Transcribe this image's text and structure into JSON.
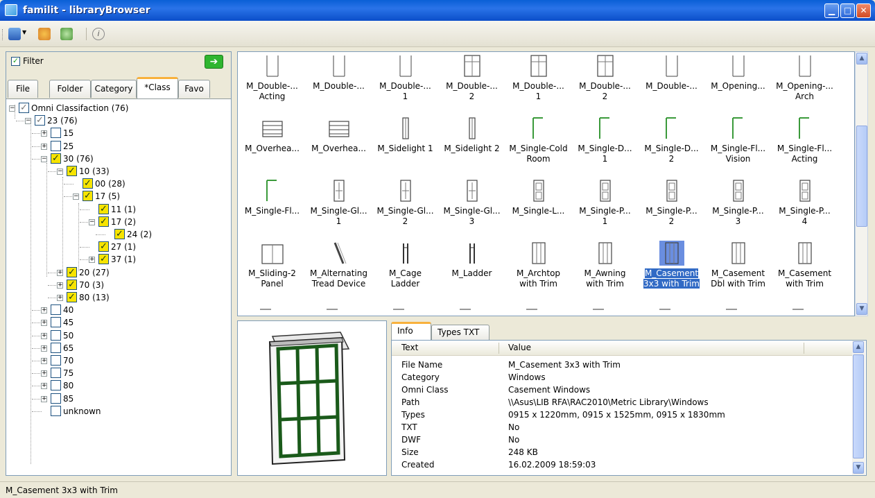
{
  "window": {
    "title": "familit - libraryBrowser",
    "minimize": "▁",
    "maximize": "□",
    "close": "✕"
  },
  "toolbar": {
    "icons": [
      "open-folder-icon",
      "palette-icon",
      "refresh-icon",
      "info-icon"
    ]
  },
  "filter": {
    "label": "Filter",
    "checked": true,
    "go_glyph": "➔"
  },
  "left_tabs": [
    {
      "label": "File",
      "active": false
    },
    {
      "label": "Folder",
      "active": false
    },
    {
      "label": "Category",
      "active": false
    },
    {
      "label": "*Class",
      "active": true
    },
    {
      "label": "Favo",
      "active": false
    }
  ],
  "tree": [
    {
      "label": "Omni Classifaction (76)",
      "depth": 0,
      "exp": "−",
      "check": "grey"
    },
    {
      "label": "23 (76)",
      "depth": 1,
      "exp": "−",
      "check": "grey"
    },
    {
      "label": "15",
      "depth": 2,
      "exp": "+",
      "check": "off"
    },
    {
      "label": "25",
      "depth": 2,
      "exp": "+",
      "check": "off"
    },
    {
      "label": "30 (76)",
      "depth": 2,
      "exp": "−",
      "check": "on"
    },
    {
      "label": "10 (33)",
      "depth": 3,
      "exp": "−",
      "check": "on"
    },
    {
      "label": "00 (28)",
      "depth": 4,
      "exp": "",
      "check": "on"
    },
    {
      "label": "17 (5)",
      "depth": 4,
      "exp": "−",
      "check": "on"
    },
    {
      "label": "11 (1)",
      "depth": 5,
      "exp": "",
      "check": "on"
    },
    {
      "label": "17 (2)",
      "depth": 5,
      "exp": "−",
      "check": "on"
    },
    {
      "label": "24 (2)",
      "depth": 6,
      "exp": "",
      "check": "on"
    },
    {
      "label": "27 (1)",
      "depth": 5,
      "exp": "",
      "check": "on"
    },
    {
      "label": "37 (1)",
      "depth": 5,
      "exp": "+",
      "check": "on"
    },
    {
      "label": "20 (27)",
      "depth": 3,
      "exp": "+",
      "check": "on"
    },
    {
      "label": "70 (3)",
      "depth": 3,
      "exp": "+",
      "check": "on"
    },
    {
      "label": "80 (13)",
      "depth": 3,
      "exp": "+",
      "check": "on"
    },
    {
      "label": "40",
      "depth": 2,
      "exp": "+",
      "check": "off"
    },
    {
      "label": "45",
      "depth": 2,
      "exp": "+",
      "check": "off"
    },
    {
      "label": "50",
      "depth": 2,
      "exp": "+",
      "check": "off"
    },
    {
      "label": "65",
      "depth": 2,
      "exp": "+",
      "check": "off"
    },
    {
      "label": "70",
      "depth": 2,
      "exp": "+",
      "check": "off"
    },
    {
      "label": "75",
      "depth": 2,
      "exp": "+",
      "check": "off"
    },
    {
      "label": "80",
      "depth": 2,
      "exp": "+",
      "check": "off"
    },
    {
      "label": "85",
      "depth": 2,
      "exp": "+",
      "check": "off"
    },
    {
      "label": "unknown",
      "depth": 2,
      "exp": "",
      "check": "off"
    }
  ],
  "families": [
    {
      "l1": "M_Double-...",
      "l2": "Acting",
      "icon": "door-frame-icon"
    },
    {
      "l1": "M_Double-...",
      "l2": "",
      "icon": "door-frame-icon"
    },
    {
      "l1": "M_Double-...",
      "l2": "1",
      "icon": "door-frame-icon"
    },
    {
      "l1": "M_Double-...",
      "l2": "2",
      "icon": "door-grid-icon"
    },
    {
      "l1": "M_Double-...",
      "l2": "1",
      "icon": "door-grid-icon"
    },
    {
      "l1": "M_Double-...",
      "l2": "2",
      "icon": "door-grid-icon"
    },
    {
      "l1": "M_Double-...",
      "l2": "",
      "icon": "door-frame-icon"
    },
    {
      "l1": "M_Opening...",
      "l2": "",
      "icon": "opening-icon"
    },
    {
      "l1": "M_Opening-...",
      "l2": "Arch",
      "icon": "opening-icon"
    },
    {
      "l1": "M_Overhea...",
      "l2": "",
      "icon": "overhead-door-icon"
    },
    {
      "l1": "M_Overhea...",
      "l2": "",
      "icon": "overhead-door-icon"
    },
    {
      "l1": "M_Sidelight 1",
      "l2": "",
      "icon": "sidelight-icon"
    },
    {
      "l1": "M_Sidelight 2",
      "l2": "",
      "icon": "sidelight-icon"
    },
    {
      "l1": "M_Single-Cold",
      "l2": "Room",
      "icon": "single-door-icon"
    },
    {
      "l1": "M_Single-D...",
      "l2": "1",
      "icon": "single-door-icon"
    },
    {
      "l1": "M_Single-D...",
      "l2": "2",
      "icon": "single-door-icon"
    },
    {
      "l1": "M_Single-Fl...",
      "l2": "Vision",
      "icon": "single-door-icon"
    },
    {
      "l1": "M_Single-Fl...",
      "l2": "Acting",
      "icon": "single-door-icon"
    },
    {
      "l1": "M_Single-Fl...",
      "l2": "",
      "icon": "single-door-icon"
    },
    {
      "l1": "M_Single-Gl...",
      "l2": "1",
      "icon": "glass-door-icon"
    },
    {
      "l1": "M_Single-Gl...",
      "l2": "2",
      "icon": "glass-door-icon"
    },
    {
      "l1": "M_Single-Gl...",
      "l2": "3",
      "icon": "glass-door-icon"
    },
    {
      "l1": "M_Single-L...",
      "l2": "",
      "icon": "louver-door-icon"
    },
    {
      "l1": "M_Single-P...",
      "l2": "1",
      "icon": "panel-door-icon"
    },
    {
      "l1": "M_Single-P...",
      "l2": "2",
      "icon": "panel-door-icon"
    },
    {
      "l1": "M_Single-P...",
      "l2": "3",
      "icon": "panel-door-icon"
    },
    {
      "l1": "M_Single-P...",
      "l2": "4",
      "icon": "panel-door-icon"
    },
    {
      "l1": "M_Sliding-2",
      "l2": "Panel",
      "icon": "sliding-door-icon"
    },
    {
      "l1": "M_Alternating",
      "l2": "Tread Device",
      "icon": "stair-icon"
    },
    {
      "l1": "M_Cage",
      "l2": "Ladder",
      "icon": "ladder-icon"
    },
    {
      "l1": "M_Ladder",
      "l2": "",
      "icon": "ladder-icon"
    },
    {
      "l1": "M_Archtop",
      "l2": "with Trim",
      "icon": "window-icon"
    },
    {
      "l1": "M_Awning",
      "l2": "with Trim",
      "icon": "window-icon"
    },
    {
      "l1": "M_Casement",
      "l2": "3x3 with Trim",
      "icon": "window-icon",
      "selected": true
    },
    {
      "l1": "M_Casement",
      "l2": "Dbl with Trim",
      "icon": "window-icon"
    },
    {
      "l1": "M_Casement",
      "l2": "with Trim",
      "icon": "window-icon"
    }
  ],
  "info": {
    "tabs": [
      {
        "label": "Info",
        "active": true
      },
      {
        "label": "Types TXT",
        "active": false
      }
    ],
    "headers": {
      "text": "Text",
      "value": "Value"
    },
    "rows": [
      {
        "key": "File Name",
        "value": "M_Casement 3x3 with Trim"
      },
      {
        "key": "Category",
        "value": "Windows"
      },
      {
        "key": "Omni Class",
        "value": "Casement Windows"
      },
      {
        "key": "Path",
        "value": "\\\\Asus\\LIB RFA\\RAC2010\\Metric Library\\Windows"
      },
      {
        "key": "Types",
        "value": "0915 x 1220mm, 0915 x 1525mm, 0915 x 1830mm"
      },
      {
        "key": "TXT",
        "value": "No"
      },
      {
        "key": "DWF",
        "value": "No"
      },
      {
        "key": "Size",
        "value": "248 KB"
      },
      {
        "key": "Created",
        "value": "16.02.2009 18:59:03"
      }
    ]
  },
  "status": {
    "text": "M_Casement 3x3 with Trim"
  },
  "colors": {
    "check_on": "#f7e400",
    "selection": "#316ac5",
    "titlebar": "#0a5fd6",
    "tab_accent": "#f8b13c"
  }
}
